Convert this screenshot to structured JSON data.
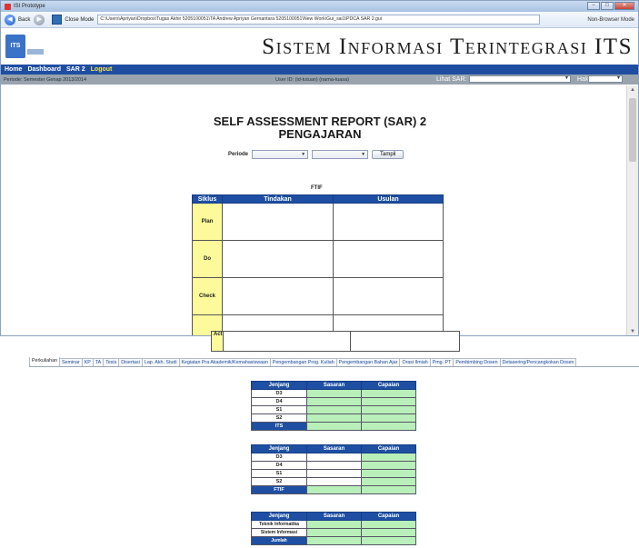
{
  "window": {
    "title": "ISI Prototype",
    "controls": [
      "−",
      "□",
      "✕"
    ]
  },
  "navbar": {
    "back_label": "Back",
    "close_mode_label": "Close Mode",
    "address": "C:\\Users\\Apriyan\\Dropbox\\Tugas Akhir 5205100051\\TA Andrew Apriyan Gernantara 5205100051\\New Work\\Gui_sai1\\PDCA SAR 2.gui",
    "non_browser_label": "Non-Browser Mode"
  },
  "site": {
    "title": "Sistem Informasi Terintegrasi ITS",
    "logo_text": "ITS"
  },
  "menu": {
    "items": [
      "Home",
      "Dashboard",
      "SAR 2"
    ],
    "logout": "Logout"
  },
  "status": {
    "periode": "Periode: Semester Genap 2013/2014",
    "user_id": "User ID: (id-tutuan) (nama-tuasa)",
    "lihat_sar": "Lihat SAR:",
    "hak_akses": "Hak Akses:"
  },
  "report": {
    "title_line1": "SELF ASSESSMENT REPORT (SAR) 2",
    "title_line2": "PENGAJARAN",
    "periode_label": "Periode",
    "tampil_label": "Tampil",
    "unit": "FTIF",
    "headers": [
      "Siklus",
      "Tindakan",
      "Usulan"
    ],
    "cycles": [
      "Plan",
      "Do",
      "Check"
    ],
    "act_label": "Act"
  },
  "tabs": [
    "Perkuliahan",
    "Seminar",
    "KP",
    "TA",
    "Tesis",
    "Disertasi",
    "Lap. Akh. Studi",
    "Kegiatan Pra Akademik/Kemahasiswaan",
    "Pengembangan Prog. Kuliah",
    "Pengembangan Bahan Ajar",
    "Orasi Ilmiah",
    "Pmg. PT",
    "Pembimbing Dosen",
    "Detasering/Pencangkokan Dosen"
  ],
  "jenjang_tables": [
    {
      "headers": [
        "Jenjang",
        "Sasaran",
        "Capaian"
      ],
      "rows": [
        "D3",
        "D4",
        "S1",
        "S2"
      ],
      "total": "ITS"
    },
    {
      "headers": [
        "Jenjang",
        "Sasaran",
        "Capaian"
      ],
      "rows": [
        "D3",
        "D4",
        "S1",
        "S2"
      ],
      "total": "FTIF"
    },
    {
      "headers": [
        "Jenjang",
        "Sasaran",
        "Capaian"
      ],
      "rows": [
        "Teknik Informatika",
        "Sistem Informasi"
      ],
      "total": "Jumlah"
    }
  ],
  "colors": {
    "header_blue": "#1e4fa3",
    "cycle_yellow": "#fdfa9c",
    "cell_green": "#b9efb9",
    "logout_yellow": "#f6e04c"
  }
}
